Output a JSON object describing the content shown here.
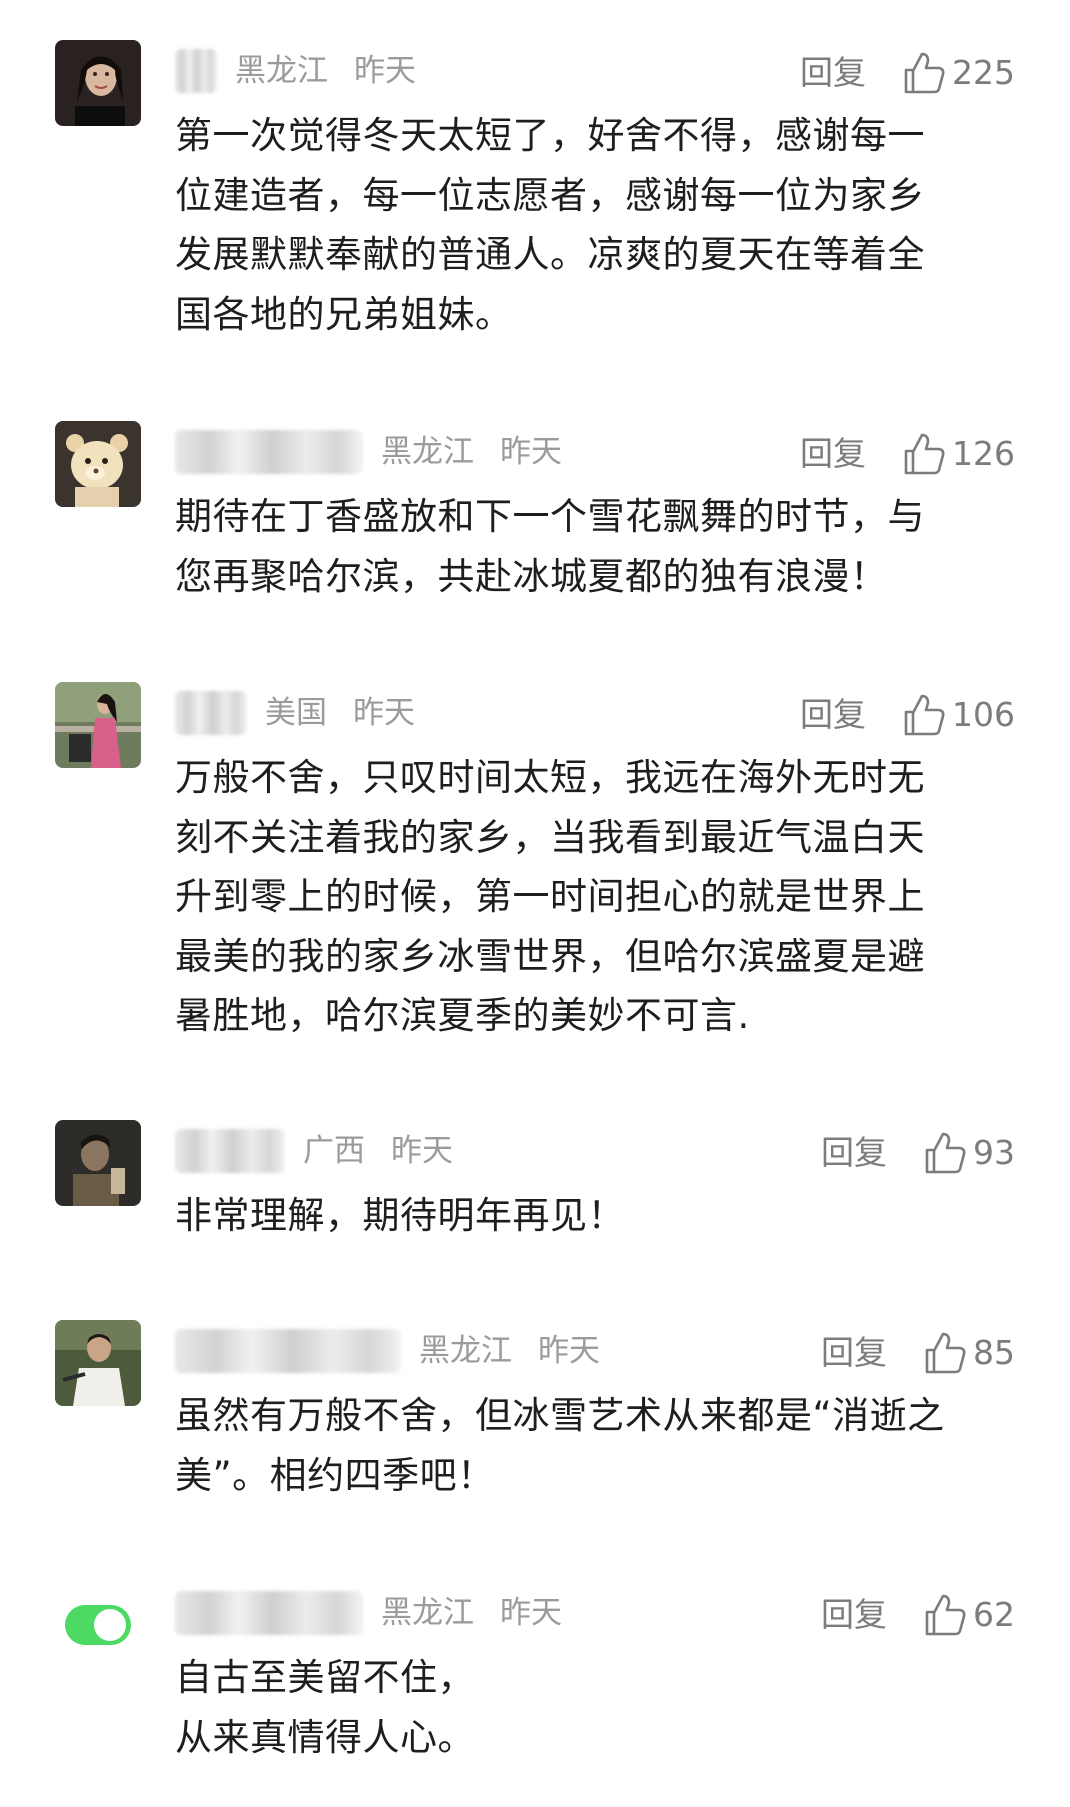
{
  "comments": [
    {
      "region": "黑龙江",
      "time": "昨天",
      "reply": "回复",
      "likes": "225",
      "avatar": "woman-portrait",
      "lines": [
        "第一次觉得冬天太短了，好舍不得，感谢每一",
        "位建造者，每一位志愿者，感谢每一位为家乡",
        "发展默默奉献的普通人。凉爽的夏天在等着全",
        "国各地的兄弟姐妹。"
      ]
    },
    {
      "region": "黑龙江",
      "time": "昨天",
      "reply": "回复",
      "likes": "126",
      "avatar": "cartoon-bear",
      "lines": [
        "期待在丁香盛放和下一个雪花飘舞的时节，与",
        "您再聚哈尔滨，共赴冰城夏都的独有浪漫！"
      ]
    },
    {
      "region": "美国",
      "time": "昨天",
      "reply": "回复",
      "likes": "106",
      "avatar": "woman-pink-dress",
      "lines": [
        "万般不舍，只叹时间太短，我远在海外无时无",
        "刻不关注着我的家乡，当我看到最近气温白天",
        "升到零上的时候，第一时间担心的就是世界上",
        "最美的我的家乡冰雪世界，但哈尔滨盛夏是避",
        "暑胜地，哈尔滨夏季的美妙不可言."
      ]
    },
    {
      "region": "广西",
      "time": "昨天",
      "reply": "回复",
      "likes": "93",
      "avatar": "man-dark-photo",
      "lines": [
        "非常理解，期待明年再见！"
      ]
    },
    {
      "region": "黑龙江",
      "time": "昨天",
      "reply": "回复",
      "likes": "85",
      "avatar": "man-outdoor",
      "lines": [
        "虽然有万般不舍，但冰雪艺术从来都是“消逝之",
        "美”。相约四季吧！"
      ]
    },
    {
      "region": "黑龙江",
      "time": "昨天",
      "reply": "回复",
      "likes": "62",
      "avatar": "green-toggle",
      "lines": [
        "自古至美留不住，",
        "从来真情得人心。"
      ]
    }
  ],
  "colors": {
    "meta": "#9b9b9b",
    "action": "#7c7c7c",
    "text": "#1e1e1e",
    "toggle": "#4cd964"
  }
}
